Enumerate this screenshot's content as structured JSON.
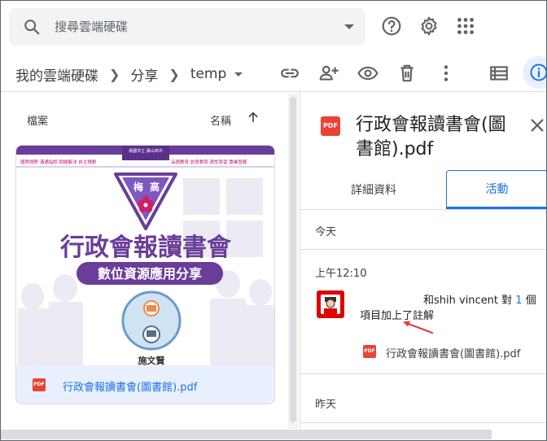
{
  "search": {
    "placeholder": "搜尋雲端硬碟"
  },
  "header_icons": [
    "help-icon",
    "settings-icon",
    "apps-grid-icon"
  ],
  "breadcrumb": {
    "root": "我的雲端硬碟",
    "level1": "分享",
    "current": "temp"
  },
  "toolbar_icons": [
    "link-icon",
    "add-person-icon",
    "preview-eye-icon",
    "trash-icon",
    "more-vert-icon",
    "list-view-icon",
    "info-icon"
  ],
  "list": {
    "col_file": "檔案",
    "col_name": "名稱",
    "sort_icon": "arrow-up-icon"
  },
  "file_card": {
    "name": "行政會報讀書會(圖書館).pdf",
    "thumbnail": {
      "banner_left": "國際視野 溝通協調 問題解決 自主規劃",
      "banner_right": "品德教育 創意教學 適性學習 專業發展",
      "school_tag": "桃園市立\n壽山高中",
      "logo_chars": [
        "梅",
        "高"
      ],
      "title": "行政會報讀書會",
      "subtitle": "數位資源應用分享",
      "presenter": "施文賢"
    }
  },
  "details_panel": {
    "file_type_badge": "PDF",
    "title": "行政會報讀書會(圖書館).pdf",
    "tabs": [
      {
        "label": "詳細資料",
        "active": false
      },
      {
        "label": "活動",
        "active": true
      }
    ],
    "sections": {
      "today": "今天",
      "yesterday": "昨天"
    },
    "activity": {
      "time": "上午12:10",
      "actor_prefix": "和shih vincent 對 ",
      "item_count": "1",
      "actor_suffix": " 個",
      "action": "項目加上了註解",
      "file": "行政會報讀書會(圖書館).pdf"
    }
  },
  "colors": {
    "accent": "#1a73e8",
    "pdf_red": "#ea4335",
    "thumb_purple": "#6a3d99",
    "selected_bg": "#e8f0fe"
  }
}
